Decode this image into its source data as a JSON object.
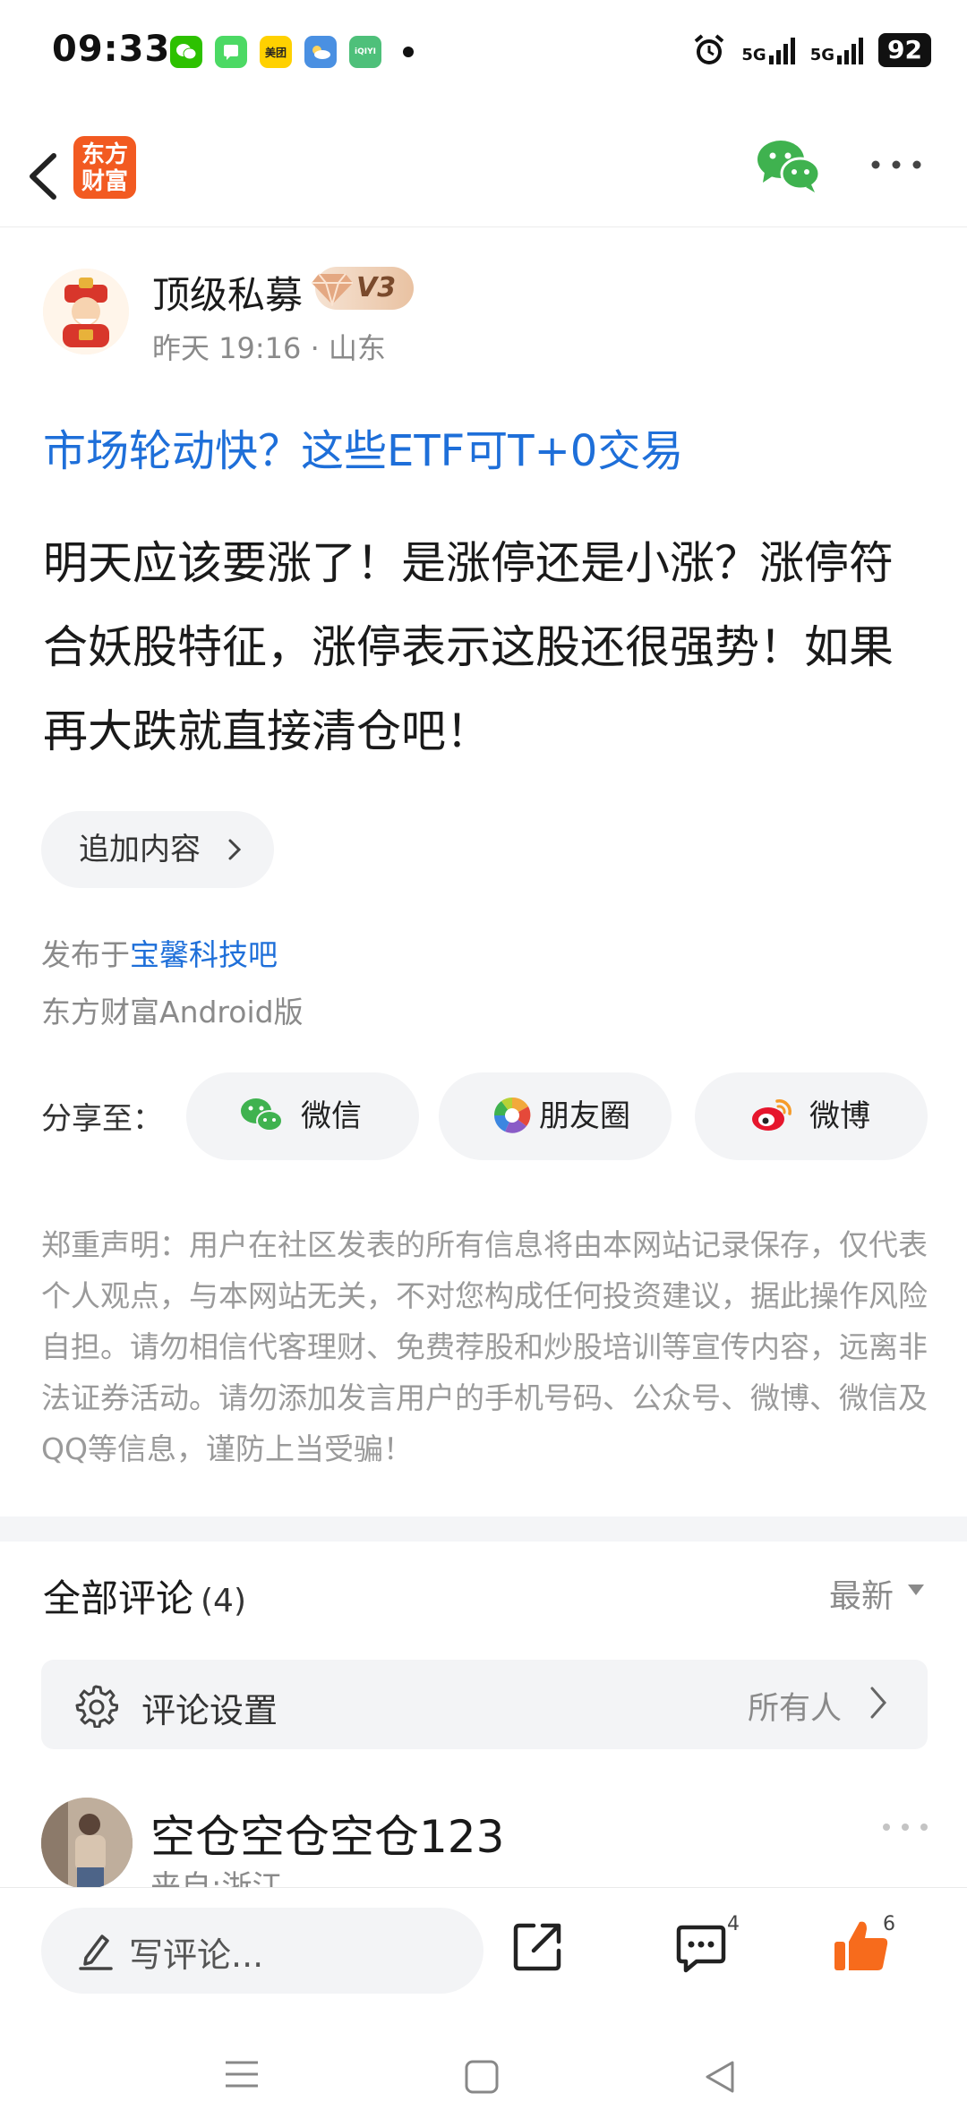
{
  "status_bar": {
    "time": "09:33",
    "battery": "92",
    "signal_1": "5G",
    "signal_2": "5G",
    "app_icons": [
      "wechat-icon",
      "messages-icon",
      "meituan-icon",
      "weather-icon",
      "iqiyi-icon"
    ],
    "meituan_label": "美团"
  },
  "nav": {
    "logo_text": "东方财富"
  },
  "post": {
    "author_name": "顶级私募",
    "vip_level": "V3",
    "meta": "昨天 19:16 · 山东",
    "title": "市场轮动快？这些ETF可T+0交易",
    "body": "明天应该要涨了！是涨停还是小涨？涨停符合妖股特征，涨停表示这股还很强势！如果再大跌就直接清仓吧！",
    "append_label": "追加内容",
    "publish_prefix": "发布于",
    "forum_name": "宝馨科技吧",
    "client": "东方财富Android版"
  },
  "share": {
    "label": "分享至：",
    "wechat": "微信",
    "moments": "朋友圈",
    "weibo": "微博"
  },
  "disclaimer": "郑重声明：用户在社区发表的所有信息将由本网站记录保存，仅代表个人观点，与本网站无关，不对您构成任何投资建议，据此操作风险自担。请勿相信代客理财、免费荐股和炒股培训等宣传内容，远离非法证券活动。请勿添加发言用户的手机号码、公众号、微博、微信及QQ等信息，谨防上当受骗！",
  "comments": {
    "title": "全部评论",
    "count": "(4)",
    "sort": "最新",
    "settings_label": "评论设置",
    "settings_value": "所有人",
    "first": {
      "name": "空仓空仓空仓123",
      "location": "来自:浙江"
    }
  },
  "bottom_bar": {
    "placeholder": "写评论...",
    "comment_count": "4",
    "like_count": "6"
  },
  "colors": {
    "link_blue": "#1e6fd9",
    "brand_orange": "#f25a21",
    "like_orange": "#f76b1c",
    "wechat_green": "#3fb24f"
  }
}
